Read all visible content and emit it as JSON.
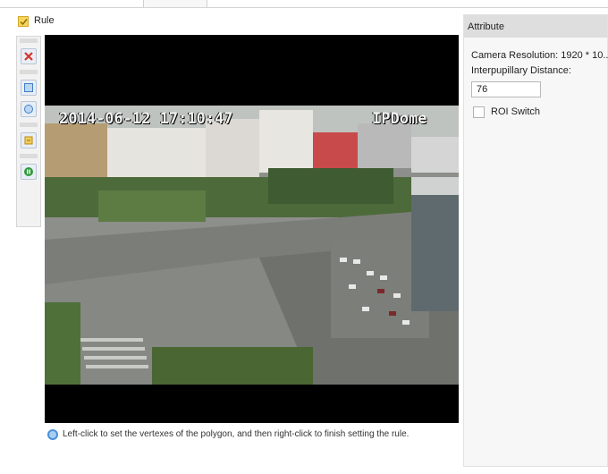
{
  "rule": {
    "label": "Rule",
    "enabled": true
  },
  "toolbar": {
    "buttons": [
      {
        "icon": "delete-icon",
        "color": "#d9342b"
      },
      {
        "icon": "zoom-in-icon",
        "color": "#3f7fc9"
      },
      {
        "icon": "zoom-out-icon",
        "color": "#3f7fc9"
      },
      {
        "icon": "edit-icon",
        "color": "#e2a51f"
      },
      {
        "icon": "play-icon",
        "color": "#2f9a3b"
      }
    ]
  },
  "video": {
    "timestamp": "2014-06-12 17:10:47",
    "camera_name": "IPDome"
  },
  "hint": {
    "text": "Left-click to set  the vertexes of the polygon, and then right-click to finish setting the rule."
  },
  "attribute_panel": {
    "title": "Attribute",
    "camera_resolution": "Camera Resolution: 1920 * 10...",
    "interpupillary_label": "Interpupillary Distance:",
    "interpupillary_value": "76",
    "roi_switch_label": "ROI Switch",
    "roi_switch_checked": false
  },
  "colors": {
    "panel_header": "#dedede",
    "accent_checkbox": "#f6d65a",
    "video_background": "#000000"
  }
}
